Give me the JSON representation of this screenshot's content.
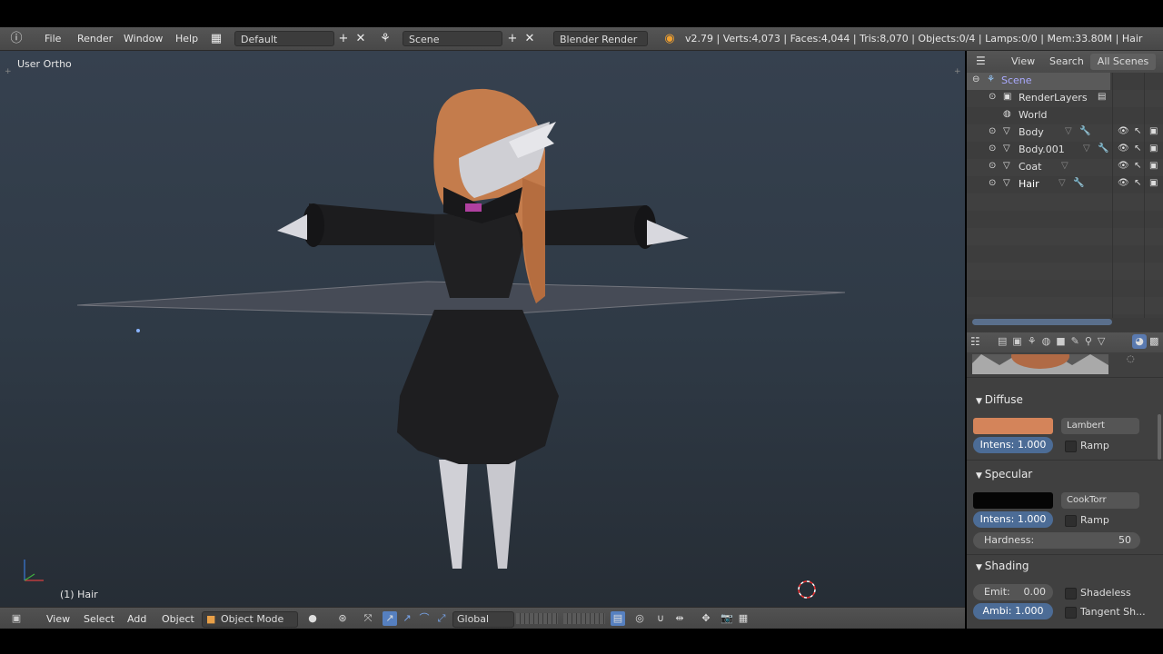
{
  "menu": {
    "file": "File",
    "render": "Render",
    "window": "Window",
    "help": "Help",
    "screen_layout": "Default",
    "scene": "Scene",
    "engine": "Blender Render",
    "stats": "v2.79 | Verts:4,073 | Faces:4,044 | Tris:8,070 | Objects:0/4 | Lamps:0/0 | Mem:33.80M | Hair"
  },
  "viewport": {
    "view_label": "User Ortho",
    "object_label": "(1) Hair",
    "colors": {
      "hair": "#c8804f",
      "coat": "#1c1c1e",
      "skin": "#d8d8dc",
      "accent": "#b040a0"
    }
  },
  "toolbar3d": {
    "view": "View",
    "select": "Select",
    "add": "Add",
    "object": "Object",
    "mode": "Object Mode",
    "orientation": "Global"
  },
  "outliner": {
    "header": {
      "view": "View",
      "search": "Search",
      "all_scenes": "All Scenes"
    },
    "rows": [
      {
        "label": "Scene"
      },
      {
        "label": "RenderLayers"
      },
      {
        "label": "World"
      },
      {
        "label": "Body"
      },
      {
        "label": "Body.001"
      },
      {
        "label": "Coat"
      },
      {
        "label": "Hair"
      }
    ]
  },
  "material": {
    "diffuse": {
      "title": "Diffuse",
      "color": "#d4845a",
      "shader": "Lambert",
      "intensity": "Intens: 1.000",
      "ramp": "Ramp"
    },
    "specular": {
      "title": "Specular",
      "color": "#050505",
      "shader": "CookTorr",
      "intensity": "Intens: 1.000",
      "ramp": "Ramp",
      "hardness_label": "Hardness:",
      "hardness_value": "50"
    },
    "shading": {
      "title": "Shading",
      "emit": "Emit:",
      "emit_value": "0.00",
      "ambi": "Ambi: 1.000",
      "shadeless": "Shadeless",
      "tangent": "Tangent Sh..."
    }
  }
}
